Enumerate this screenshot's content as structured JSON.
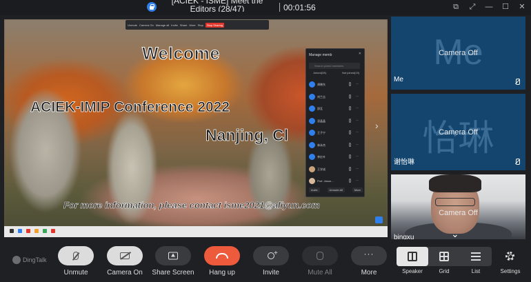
{
  "titlebar": {
    "title": "[ACIEK - ISME] Meet the Editors (28/47)",
    "timer": "00:01:56",
    "controls": [
      "⧉",
      "⤢",
      "—",
      "☐",
      "✕"
    ]
  },
  "shared_screen": {
    "toolbar_items": [
      "Unmute",
      "Camera On",
      "Manage all",
      "Invite",
      "Share",
      "More",
      "Stop",
      "Stop Sharing"
    ],
    "slide": {
      "welcome": "Welcome",
      "conference": "ACIEK-IMIP Conference 2022",
      "city": "Nanjing, Cl",
      "info": "For more information, please contact isme2021@aliyun.com"
    },
    "manage_panel": {
      "title": "Manage memb",
      "close": "✕",
      "search_placeholder": "Search joined members",
      "tabs": [
        "Joined(28)",
        "Not joined(19)"
      ],
      "members": [
        "胡晓东",
        "刘兰吉",
        "邵瓦",
        "凌晶晶",
        "王子宁",
        "林永杰",
        "李红叶",
        "王学成",
        "Prof. Jason..."
      ],
      "buttons": [
        "Invite",
        "Unmute All",
        "More"
      ]
    }
  },
  "tiles": [
    {
      "big_text": "Me",
      "status": "Camera Off",
      "name": "Me"
    },
    {
      "big_text": "怡琳",
      "status": "Camera Off",
      "name": "谢怡琳"
    },
    {
      "status": "Camera Off",
      "name": "bingxu"
    }
  ],
  "toolbar": {
    "logo": "DingTalk",
    "unmute": "Unmute",
    "camera_on": "Camera On",
    "share_screen": "Share Screen",
    "hang_up": "Hang up",
    "invite": "Invite",
    "mute_all": "Mute All",
    "more": "More",
    "more_glyph": "···",
    "speaker": "Speaker",
    "grid": "Grid",
    "list": "List",
    "settings": "Settings"
  },
  "colors": {
    "background": "#1f2023",
    "tile_blue": "#14456e",
    "hangup_red": "#ee5a3c",
    "accent_blue": "#2f80ed"
  }
}
